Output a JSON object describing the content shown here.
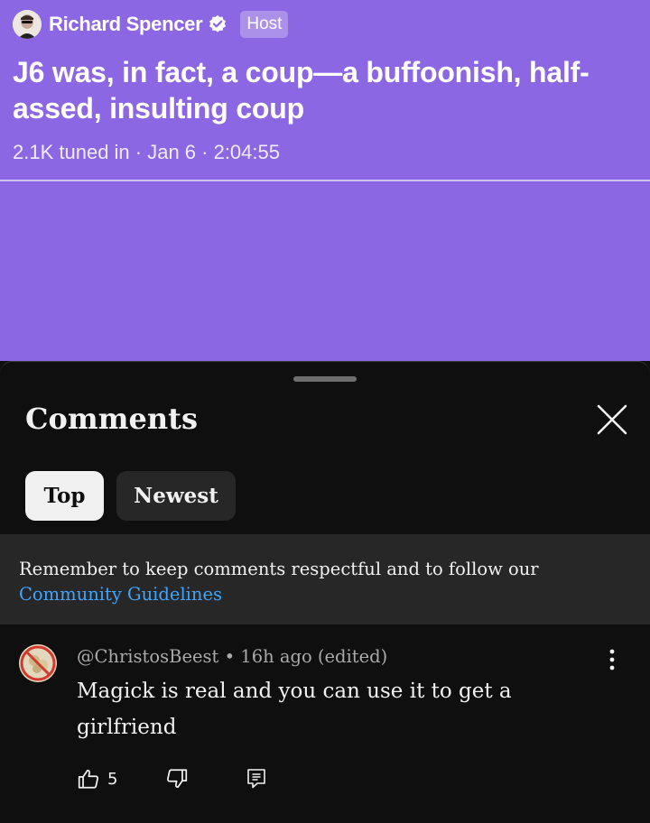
{
  "stream": {
    "host_name": "Richard Spencer",
    "host_badge": "Host",
    "title": "J6 was, in fact, a coup—a buffoonish, half-assed, insulting coup",
    "meta": "2.1K tuned in · Jan 6 · 2:04:55",
    "bg_color": "#8c67e3"
  },
  "comments_panel": {
    "title": "Comments",
    "close_icon": "close-icon",
    "tabs": [
      {
        "label": "Top",
        "selected": true
      },
      {
        "label": "Newest",
        "selected": false
      }
    ],
    "banner": {
      "text": "Remember to keep comments respectful and to follow our",
      "link": "Community Guidelines"
    },
    "comments": [
      {
        "author": "@ChristosBeest",
        "meta_rest": "• 16h ago (edited)",
        "text": "Magick is real and you can use it to get a girlfriend",
        "likes": "5"
      }
    ]
  },
  "colors": {
    "accent_link": "#3ea6ff",
    "panel_bg": "#0f0f0f",
    "chip_bg": "#272727"
  }
}
